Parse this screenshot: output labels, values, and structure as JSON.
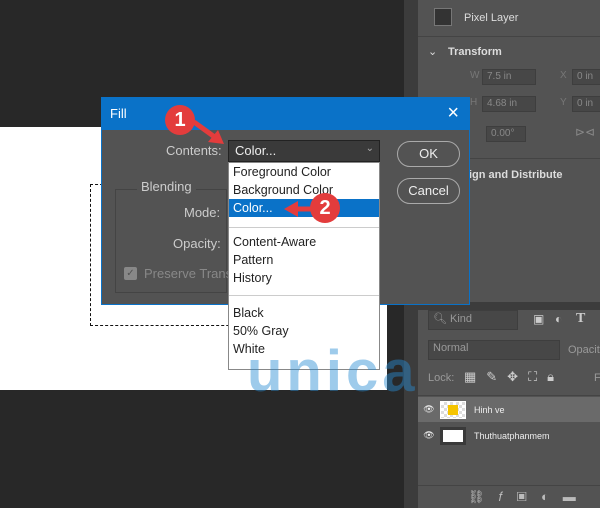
{
  "properties": {
    "header": "Pixel Layer",
    "transform": "Transform",
    "w_label": "W",
    "w_value": "7.5 in",
    "h_label": "H",
    "h_value": "4.68 in",
    "x_label": "X",
    "x_value": "0 in",
    "y_label": "Y",
    "y_value": "0 in",
    "angle_value": "0.00°",
    "align": "Align and Distribute"
  },
  "layers": {
    "kind": "Kind",
    "blend_mode": "Normal",
    "opacity_label": "Opacity",
    "lock_label": "Lock:",
    "fill_label": "Fi",
    "items": [
      {
        "name": "Hinh ve",
        "selected": true
      },
      {
        "name": "Thuthuatphanmem",
        "selected": false
      }
    ]
  },
  "dialog": {
    "title": "Fill",
    "contents_label": "Contents:",
    "contents_value": "Color...",
    "blending": "Blending",
    "mode_label": "Mode:",
    "opacity_label": "Opacity:",
    "preserve": "Preserve Trans",
    "ok": "OK",
    "cancel": "Cancel",
    "options": [
      "Foreground Color",
      "Background Color",
      "Color...",
      "Content-Aware",
      "Pattern",
      "History",
      "Black",
      "50% Gray",
      "White"
    ]
  },
  "annotations": {
    "step1": "1",
    "step2": "2"
  },
  "watermark": "unica",
  "colors": {
    "accent": "#0a72c8",
    "badge": "#e33c3c"
  }
}
